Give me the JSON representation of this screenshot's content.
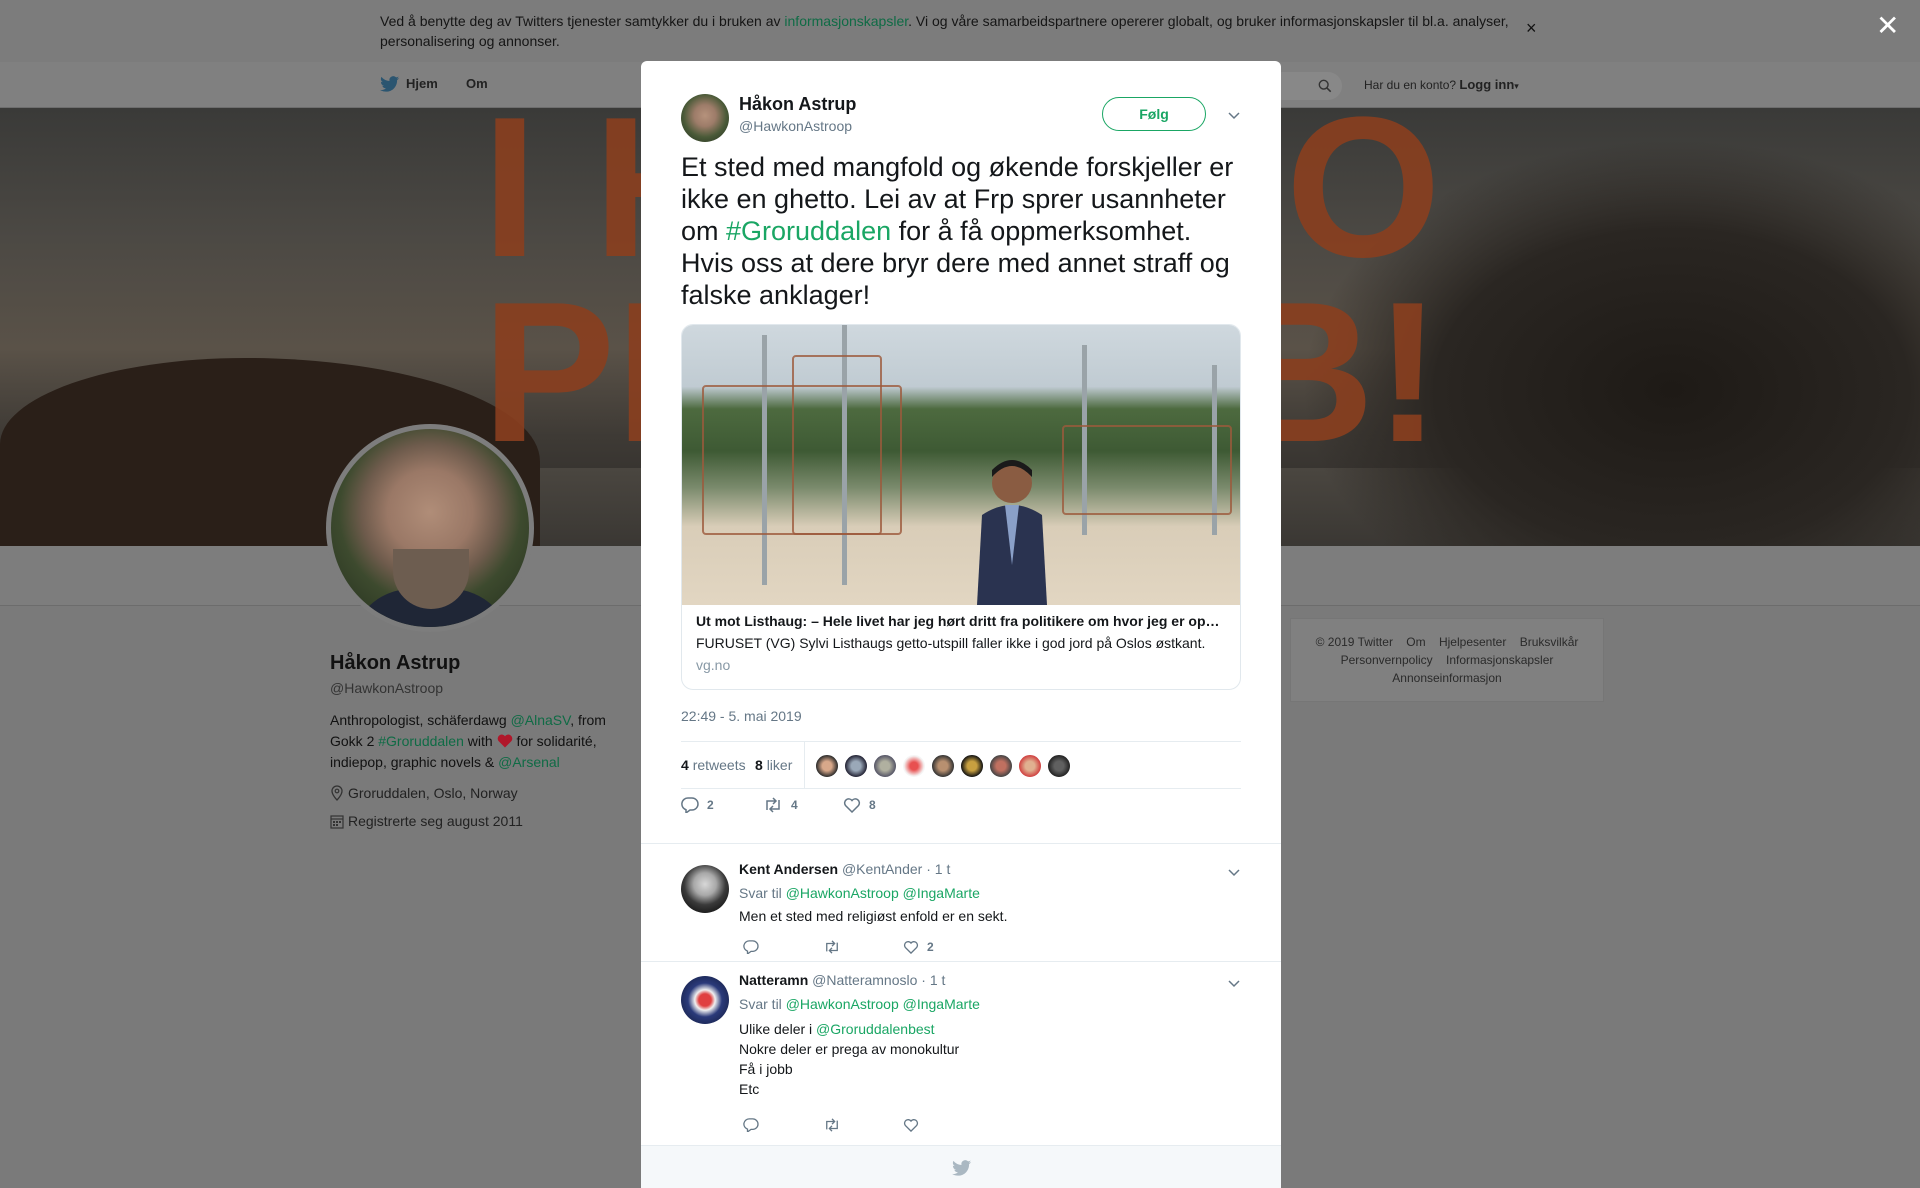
{
  "cookie_bar": {
    "text_before": "Ved å benytte deg av Twitters tjenester samtykker du i bruken av ",
    "link": "informasjonskapsler",
    "text_after": ". Vi og våre samarbeidspartnere opererer globalt, og bruker informasjonskapsler til bl.a. analyser, personalisering og annonser.",
    "close": "×"
  },
  "nav": {
    "home": "Hjem",
    "about": "Om",
    "account_prompt": "Har du en konto?",
    "login": "Logg inn"
  },
  "banner_text": [
    "I H",
    "IO",
    "PL",
    "B!"
  ],
  "profile": {
    "name": "Håkon Astrup",
    "handle": "@HawkonAstroop",
    "bio_1": "Anthropologist, schäferdawg ",
    "bio_link_1": "@AlnaSV",
    "bio_2": ", from Gokk 2 ",
    "bio_link_2": "#Groruddalen",
    "bio_3": " with ",
    "bio_4": " for solidarité, indiepop, graphic novels & ",
    "bio_link_3": "@Arsenal",
    "location": "Groruddalen, Oslo, Norway",
    "joined": "Registrerte seg august 2011"
  },
  "footer": {
    "items": [
      "© 2019 Twitter",
      "Om",
      "Hjelpesenter",
      "Bruksvilkår",
      "Personvernpolicy",
      "Informasjonskapsler",
      "Annonseinformasjon"
    ]
  },
  "modal_close": "✕",
  "tweet": {
    "name": "Håkon Astrup",
    "handle": "@HawkonAstroop",
    "follow": "Følg",
    "text_1": "Et sted med mangfold og økende forskjeller er ikke en ghetto. Lei av at Frp sprer usannheter om ",
    "hashtag": "#Groruddalen",
    "text_2": " for å få oppmerksomhet. Hvis oss at dere bryr dere med annet straff og falske anklager!",
    "card": {
      "title": "Ut mot Listhaug: – Hele livet har jeg hørt dritt fra politikere om hvor jeg er oppvokst",
      "description": "FURUSET (VG) Sylvi Listhaugs getto-utspill faller ikke i god jord på Oslos østkant.",
      "domain": "vg.no"
    },
    "time": "22:49 - 5. mai 2019",
    "retweets_count": "4",
    "retweets_label": "retweets",
    "likes_count": "8",
    "likes_label": "liker",
    "reply_count": "2",
    "retweet_action_count": "4",
    "like_action_count": "8"
  },
  "replies": [
    {
      "name": "Kent Andersen",
      "handle": "@KentAnder",
      "time": "· 1 t",
      "to_label": "Svar til",
      "to_1": "@HawkonAstroop",
      "to_2": "@IngaMarte",
      "lines": [
        "Men et sted med religiøst enfold er en sekt."
      ],
      "like_count": "2"
    },
    {
      "name": "Natteramn",
      "handle": "@Natteramnoslo",
      "time": "· 1 t",
      "to_label": "Svar til",
      "to_1": "@HawkonAstroop",
      "to_2": "@IngaMarte",
      "line1_text": "Ulike deler i ",
      "line1_link": "@Groruddalenbest",
      "lines": [
        "Nokre deler er prega av monokultur",
        "Få i jobb",
        "Etc"
      ],
      "like_count": ""
    }
  ],
  "colors": {
    "accent": "#1aa664",
    "text": "#14171a",
    "muted": "#657786",
    "dim_overlay": "#7a7a7a"
  },
  "icons": [
    "twitter-bird-icon",
    "search-icon",
    "close-icon",
    "chevron-down-icon",
    "location-icon",
    "calendar-icon",
    "heart-icon",
    "reply-icon",
    "retweet-icon",
    "like-icon"
  ]
}
